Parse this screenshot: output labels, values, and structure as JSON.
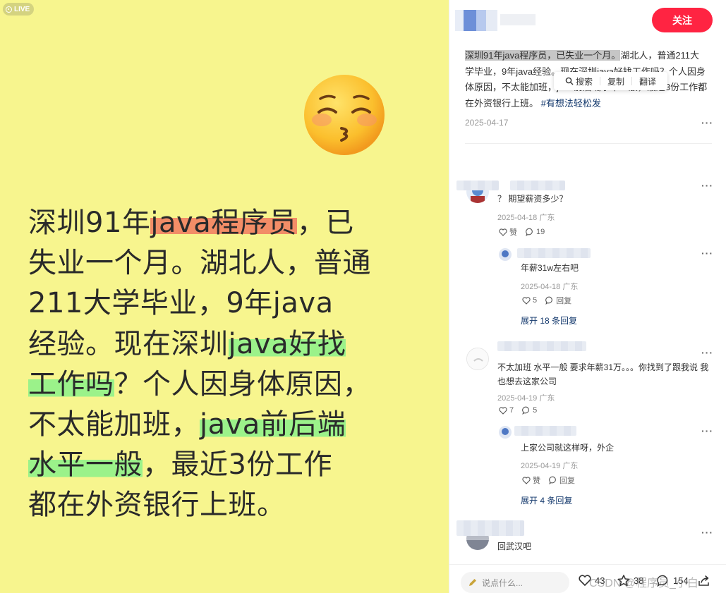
{
  "image": {
    "live_label": "LIVE",
    "emoji_name": "kissing-face-closed-eyes",
    "lines": [
      {
        "pre": "深圳91年",
        "hl": "java程序员",
        "hl_color": "red",
        "post": "，已"
      },
      {
        "pre": "失业一个月。湖北人，普通",
        "hl": "",
        "hl_color": "",
        "post": ""
      },
      {
        "pre": "211大学毕业，9年java",
        "hl": "",
        "hl_color": "",
        "post": ""
      },
      {
        "pre": "经验。现在深圳",
        "hl": "java好找",
        "hl_color": "green",
        "post": ""
      },
      {
        "pre": "",
        "hl": "工作吗",
        "hl_color": "green",
        "post": "？个人因身体原因，"
      },
      {
        "pre": "不太能加班，",
        "hl": "java前后端",
        "hl_color": "green",
        "post": ""
      },
      {
        "pre": "",
        "hl": "水平一般",
        "hl_color": "green",
        "post": "，最近3份工作"
      },
      {
        "pre": "都在外资银行上班。",
        "hl": "",
        "hl_color": "",
        "post": ""
      }
    ]
  },
  "header": {
    "follow_label": "关注"
  },
  "post": {
    "desc_selected": "深圳91年java程序员，已失业一个月。",
    "desc_rest": "湖北人，普通211大学毕业，9年java经验。现在深圳java好找工作吗？个人因身体原因，不太能加班，java前后端水平一般，最近3份工作都在外资银行上班。",
    "hashtag": "#有想法轻松发",
    "date": "2025-04-17",
    "context_menu": {
      "search": "搜索",
      "copy": "复制",
      "translate": "翻译"
    }
  },
  "comments": [
    {
      "text": "？ 期望薪资多少？",
      "meta": "2025-04-18 广东",
      "likes": "赞",
      "replies": "19",
      "sub": {
        "text": "年薪31w左右吧",
        "meta": "2025-04-18 广东",
        "likes": "5",
        "replies": "回复"
      },
      "expand": "展开 18 条回复"
    },
    {
      "text": "不太加班 水平一般 要求年薪31万。。。你找到了跟我说 我也想去这家公司",
      "meta": "2025-04-19 广东",
      "likes": "7",
      "replies": "5",
      "sub": {
        "text": "上家公司就这样呀，外企",
        "meta": "2025-04-19 广东",
        "likes": "赞",
        "replies": "回复"
      },
      "expand": "展开 4 条回复"
    },
    {
      "text": "回武汉吧"
    }
  ],
  "bottom": {
    "input_placeholder": "说点什么...",
    "likes": "43",
    "collects": "38",
    "comments": "154",
    "watermark": "CSDN @程序员_小白"
  },
  "colors": {
    "accent": "#ff2442",
    "link": "#13386c",
    "bg_image": "#f7f58e"
  }
}
